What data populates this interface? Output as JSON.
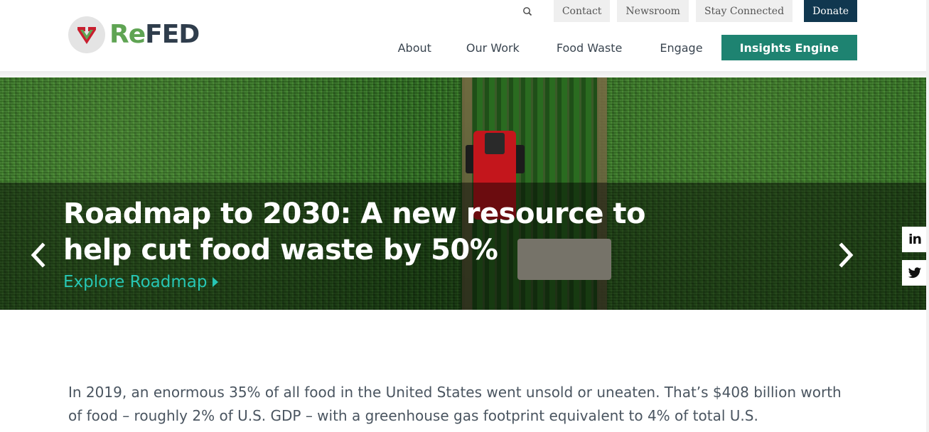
{
  "brand": {
    "logo_re": "Re",
    "logo_fed": "FED"
  },
  "utility_nav": {
    "search_icon": "search-icon",
    "items": [
      {
        "label": "Contact"
      },
      {
        "label": "Newsroom"
      },
      {
        "label": "Stay Connected"
      }
    ],
    "donate_label": "Donate"
  },
  "main_nav": {
    "items": [
      {
        "label": "About"
      },
      {
        "label": "Our Work"
      },
      {
        "label": "Food Waste"
      },
      {
        "label": "Engage"
      }
    ],
    "cta_label": "Insights Engine"
  },
  "hero": {
    "title": "Roadmap to 2030: A new resource to help cut food waste by 50%",
    "link_label": "Explore Roadmap",
    "prev_icon": "chevron-left-icon",
    "next_icon": "chevron-right-icon"
  },
  "social": {
    "linkedin_label": "in",
    "twitter_icon": "twitter-icon"
  },
  "intro": {
    "text": "In 2019, an enormous 35% of all food in the United States went unsold or uneaten. That’s $408 billion worth of food – roughly 2% of U.S. GDP – with a greenhouse gas footprint equivalent to 4% of total U.S."
  },
  "colors": {
    "brand_green": "#5fa453",
    "brand_navy": "#2f3d4c",
    "donate_bg": "#10374f",
    "cta_teal": "#1e8371",
    "link_teal": "#27c6b3"
  }
}
